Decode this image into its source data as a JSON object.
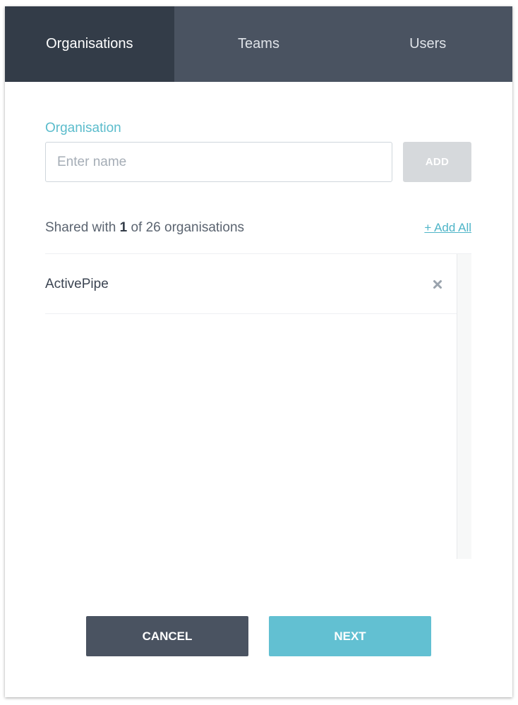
{
  "tabs": [
    {
      "label": "Organisations",
      "active": true
    },
    {
      "label": "Teams",
      "active": false
    },
    {
      "label": "Users",
      "active": false
    }
  ],
  "form": {
    "label": "Organisation",
    "input_value": "",
    "placeholder": "Enter name",
    "add_label": "ADD"
  },
  "shared": {
    "prefix": "Shared with",
    "count": "1",
    "suffix": "of 26 organisations",
    "add_all_label": "+ Add All"
  },
  "list": {
    "items": [
      {
        "name": "ActivePipe",
        "remove_icon": "close-icon"
      }
    ]
  },
  "footer": {
    "cancel_label": "CANCEL",
    "next_label": "NEXT"
  },
  "colors": {
    "tab_bar": "#4a5361",
    "tab_active": "#333c48",
    "accent": "#5bbccc",
    "next_button": "#62c0d2",
    "cancel_button": "#4a5361",
    "add_disabled": "#d6d9dc"
  }
}
